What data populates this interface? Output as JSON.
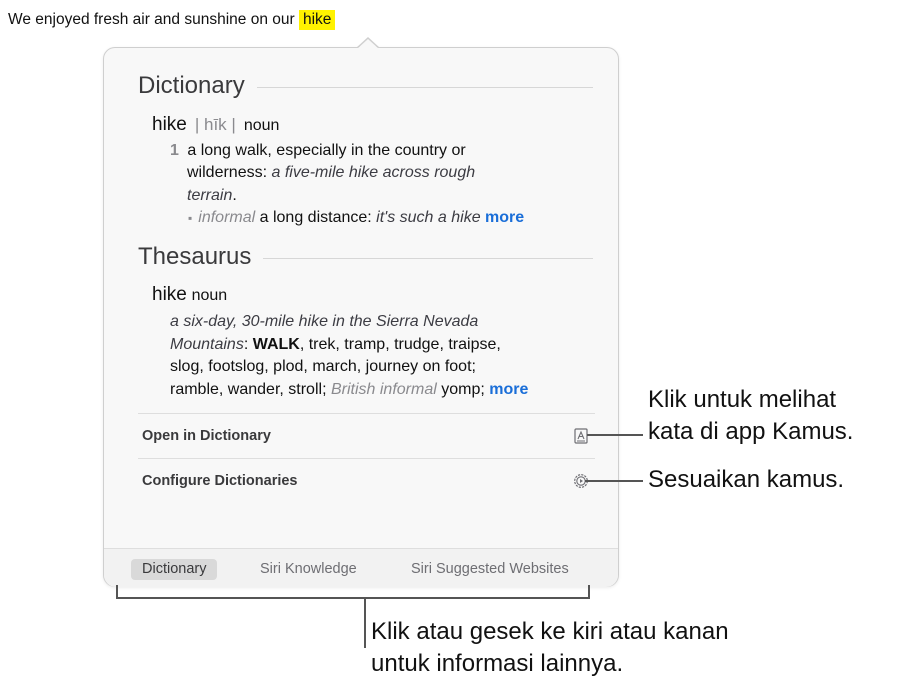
{
  "sentence": {
    "text": "We enjoyed fresh air and sunshine on our",
    "highlight": "hike"
  },
  "dictionary": {
    "heading": "Dictionary",
    "headword": "hike",
    "pronunciation": "| hīk |",
    "pos": "noun",
    "sense_number": "1",
    "definition_1": "a long walk, especially in the country or",
    "definition_2": "wilderness:",
    "example_1": "a five-mile hike across rough",
    "example_2": "terrain",
    "period": ".",
    "subsense_register": "informal",
    "subsense_text": "a long distance:",
    "subsense_example": "it's such a hike",
    "more": "more"
  },
  "thesaurus": {
    "heading": "Thesaurus",
    "headword": "hike",
    "pos": "noun",
    "example_1": "a six-day, 30-mile hike in the Sierra Nevada",
    "example_2": "Mountains",
    "colon": ":",
    "first_syn": "WALK",
    "syn_1": ", trek, tramp, trudge, traipse,",
    "syn_2": "slog, footslog, plod, march, journey on foot;",
    "syn_3": "ramble, wander, stroll;",
    "register": "British informal",
    "syn_4": "yomp;",
    "more": "more"
  },
  "actions": {
    "open_dictionary": "Open in Dictionary",
    "configure": "Configure Dictionaries"
  },
  "tabs": [
    "Dictionary",
    "Siri Knowledge",
    "Siri Suggested Websites"
  ],
  "active_tab": "Dictionary",
  "callouts": {
    "open_1": "Klik untuk melihat",
    "open_2": "kata di app Kamus.",
    "configure": "Sesuaikan kamus.",
    "swipe_1": "Klik atau gesek ke kiri atau kanan",
    "swipe_2": "untuk informasi lainnya."
  },
  "icons": {
    "open": "dictionary-book-icon",
    "configure": "gear-icon"
  },
  "colors": {
    "highlight": "#fff200",
    "link": "#1a6ed8"
  }
}
